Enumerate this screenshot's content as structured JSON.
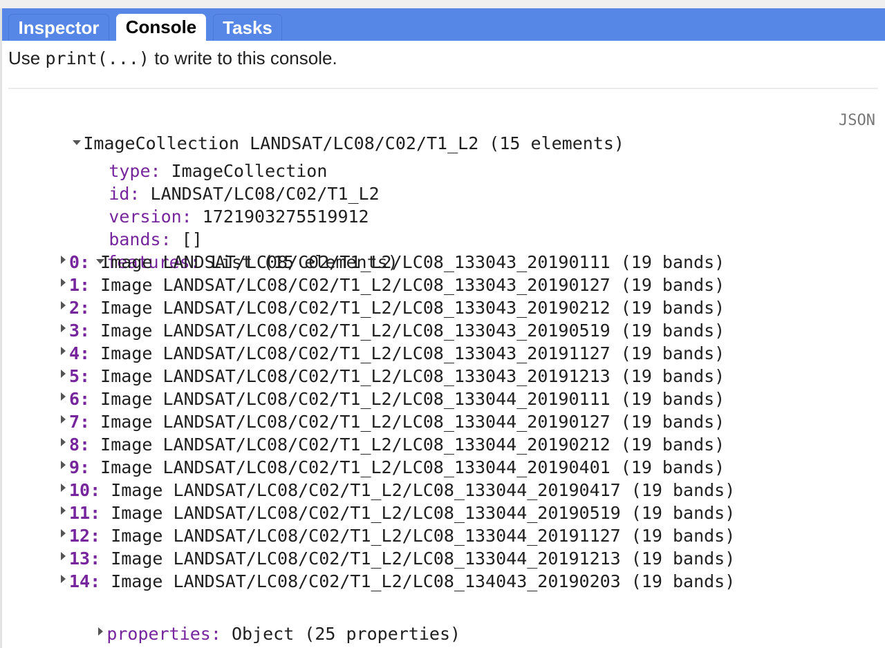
{
  "tabs": [
    {
      "label": "Inspector",
      "active": false
    },
    {
      "label": "Console",
      "active": true
    },
    {
      "label": "Tasks",
      "active": false
    }
  ],
  "colors": {
    "tabbar": "#5686e6",
    "key_purple": "#76259d",
    "text": "#202020",
    "json_link": "#777777"
  },
  "console": {
    "intro_prefix": "Use ",
    "intro_code": "print(...)",
    "intro_suffix": " to write to this console.",
    "json_link": "JSON",
    "root": {
      "label": "ImageCollection LANDSAT/LC08/C02/T1_L2 (15 elements)",
      "expanded": true,
      "fields": [
        {
          "key": "type:",
          "value": " ImageCollection"
        },
        {
          "key": "id:",
          "value": " LANDSAT/LC08/C02/T1_L2"
        },
        {
          "key": "version:",
          "value": " 1721903275519912"
        },
        {
          "key": "bands:",
          "value": " []"
        }
      ],
      "features": {
        "key": "features:",
        "value": " List (15 elements)",
        "expanded": true,
        "items": [
          {
            "index": "0:",
            "value": " Image LANDSAT/LC08/C02/T1_L2/LC08_133043_20190111 (19 bands)"
          },
          {
            "index": "1:",
            "value": " Image LANDSAT/LC08/C02/T1_L2/LC08_133043_20190127 (19 bands)"
          },
          {
            "index": "2:",
            "value": " Image LANDSAT/LC08/C02/T1_L2/LC08_133043_20190212 (19 bands)"
          },
          {
            "index": "3:",
            "value": " Image LANDSAT/LC08/C02/T1_L2/LC08_133043_20190519 (19 bands)"
          },
          {
            "index": "4:",
            "value": " Image LANDSAT/LC08/C02/T1_L2/LC08_133043_20191127 (19 bands)"
          },
          {
            "index": "5:",
            "value": " Image LANDSAT/LC08/C02/T1_L2/LC08_133043_20191213 (19 bands)"
          },
          {
            "index": "6:",
            "value": " Image LANDSAT/LC08/C02/T1_L2/LC08_133044_20190111 (19 bands)"
          },
          {
            "index": "7:",
            "value": " Image LANDSAT/LC08/C02/T1_L2/LC08_133044_20190127 (19 bands)"
          },
          {
            "index": "8:",
            "value": " Image LANDSAT/LC08/C02/T1_L2/LC08_133044_20190212 (19 bands)"
          },
          {
            "index": "9:",
            "value": " Image LANDSAT/LC08/C02/T1_L2/LC08_133044_20190401 (19 bands)"
          },
          {
            "index": "10:",
            "value": " Image LANDSAT/LC08/C02/T1_L2/LC08_133044_20190417 (19 bands)"
          },
          {
            "index": "11:",
            "value": " Image LANDSAT/LC08/C02/T1_L2/LC08_133044_20190519 (19 bands)"
          },
          {
            "index": "12:",
            "value": " Image LANDSAT/LC08/C02/T1_L2/LC08_133044_20191127 (19 bands)"
          },
          {
            "index": "13:",
            "value": " Image LANDSAT/LC08/C02/T1_L2/LC08_133044_20191213 (19 bands)"
          },
          {
            "index": "14:",
            "value": " Image LANDSAT/LC08/C02/T1_L2/LC08_134043_20190203 (19 bands)"
          }
        ]
      },
      "properties": {
        "key": "properties:",
        "value": " Object (25 properties)",
        "expanded": false
      }
    }
  }
}
